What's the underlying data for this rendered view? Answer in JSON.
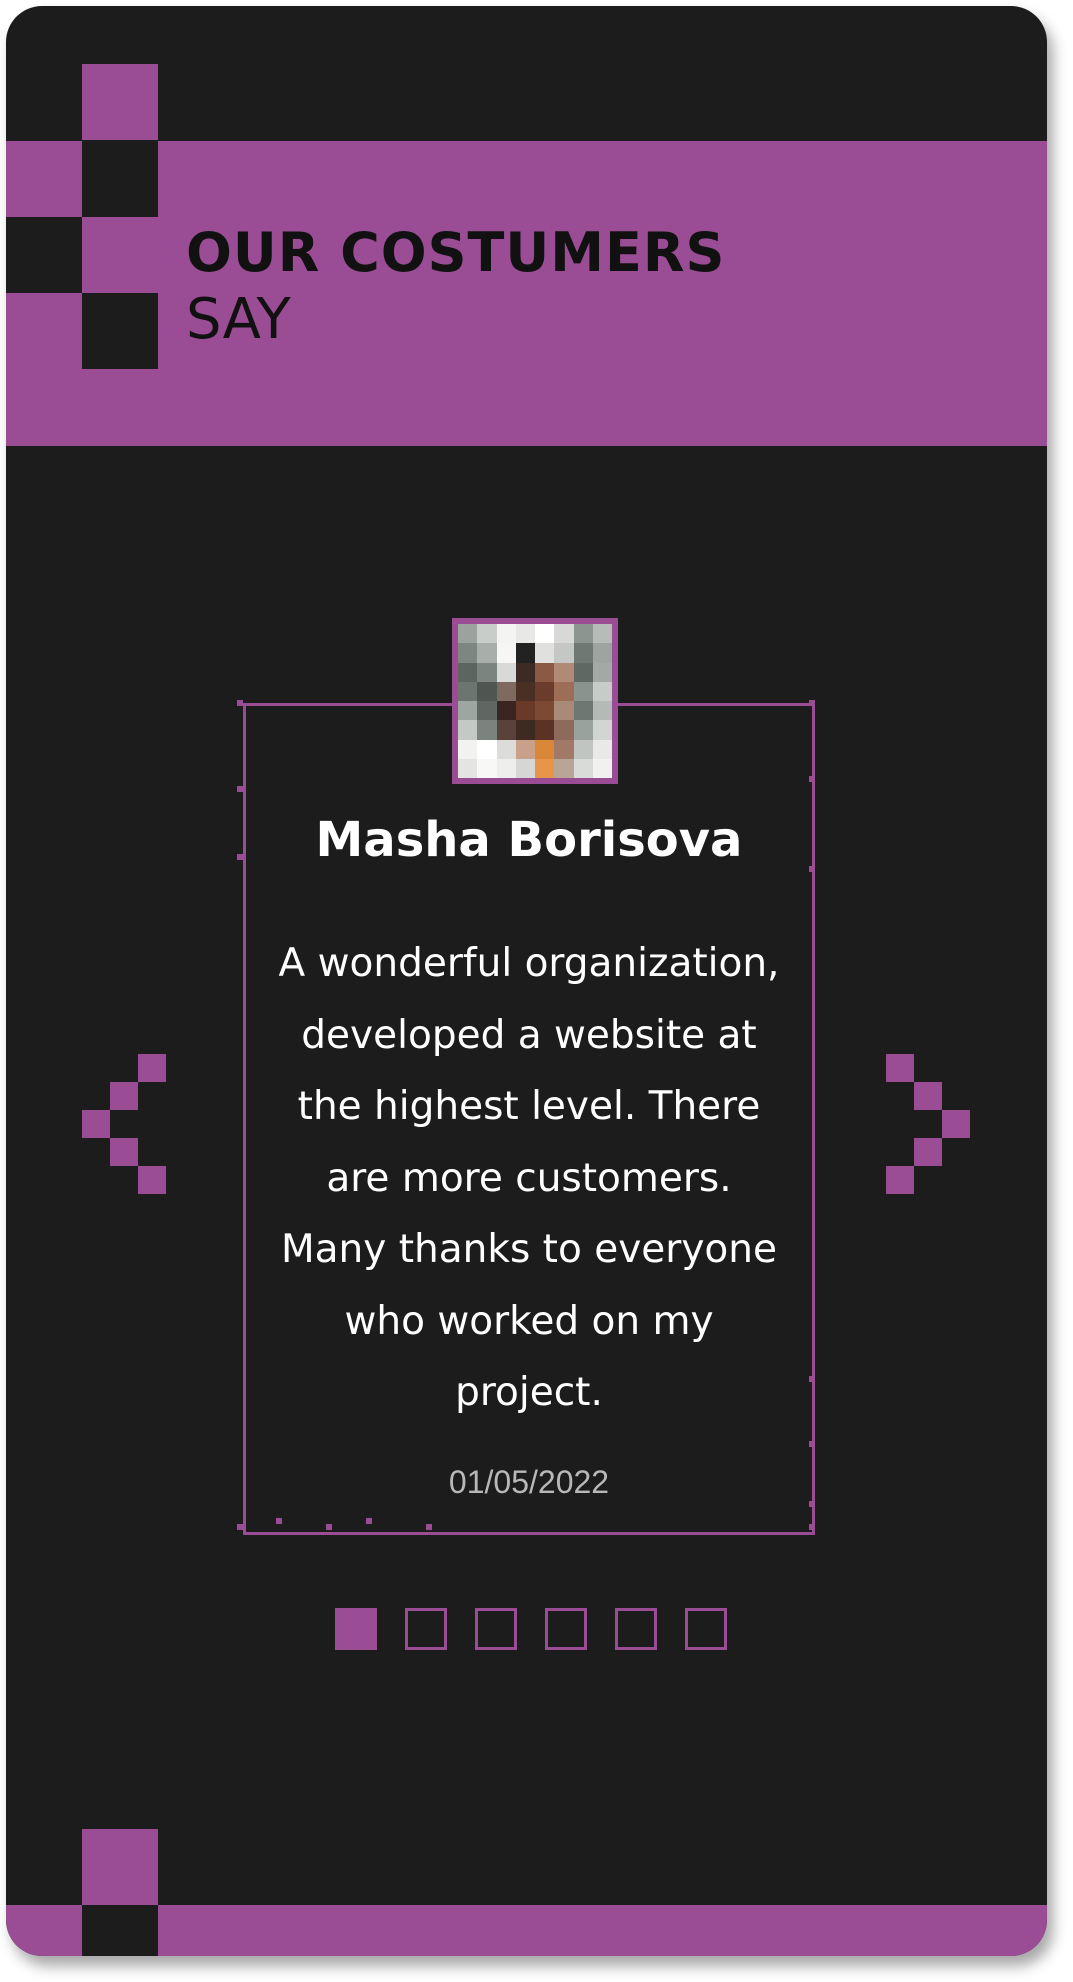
{
  "header": {
    "title_bold": "OUR COSTUMERS",
    "title_light": "SAY"
  },
  "testimonial": {
    "name": "Masha Borisova",
    "text": "A wonderful organization, developed a website at the highest level. There are more customers. Many thanks to everyone who worked on my project.",
    "date": "01/05/2022",
    "avatar_icon": "pixelated-photo-icon"
  },
  "carousel": {
    "prev_icon": "chevron-left-icon",
    "next_icon": "chevron-right-icon",
    "dot_count": 6,
    "active_index": 0
  },
  "colors": {
    "accent": "#9a4c94",
    "background": "#1d1c1d",
    "text": "#ffffff",
    "date_text": "#b8b8b8"
  }
}
